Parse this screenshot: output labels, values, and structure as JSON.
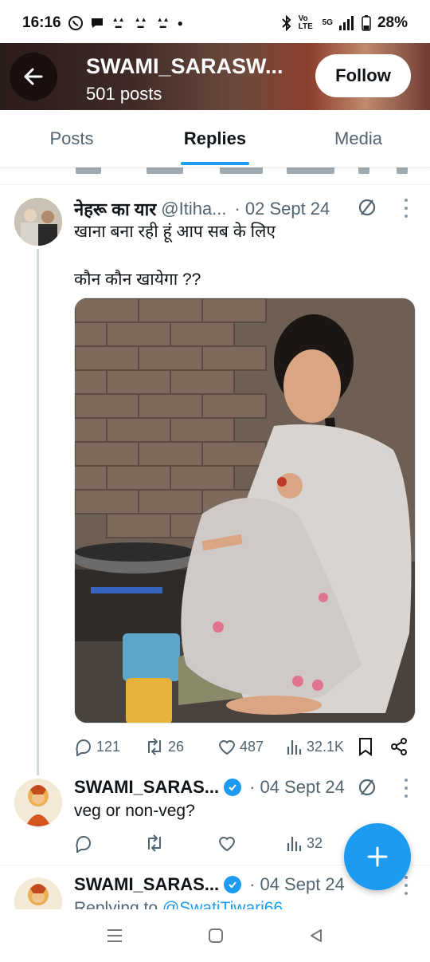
{
  "status_bar": {
    "time": "16:16",
    "battery": "28%",
    "network": "5G",
    "volte": "Vo LTE"
  },
  "header": {
    "title": "SWAMI_SARASW...",
    "posts_count": "501 posts",
    "follow_label": "Follow"
  },
  "tabs": [
    {
      "label": "Posts",
      "active": false
    },
    {
      "label": "Replies",
      "active": true
    },
    {
      "label": "Media",
      "active": false
    }
  ],
  "tweets": [
    {
      "name": "नेहरू का यार",
      "handle": "@Itiha...",
      "date": "02 Sept 24",
      "text_line1": "खाना बना रही हूं आप सब के लिए",
      "text_line2": "कौन कौन खायेगा ??",
      "replies": "121",
      "retweets": "26",
      "likes": "487",
      "views": "32.1K"
    },
    {
      "name": "SWAMI_SARAS...",
      "date": "04 Sept 24",
      "text": "veg or non-veg?",
      "views": "32"
    },
    {
      "name": "SWAMI_SARAS...",
      "date": "04 Sept 24",
      "replying_to_prefix": "Replying to ",
      "replying_to_handle": "@SwatiTiwari66"
    }
  ],
  "colors": {
    "accent": "#1d9bf0",
    "text_primary": "#0f1419",
    "text_secondary": "#536471"
  },
  "icons": [
    "back-arrow-icon",
    "ban-icon",
    "more-icon",
    "reply-icon",
    "retweet-icon",
    "like-icon",
    "views-icon",
    "bookmark-icon",
    "share-icon",
    "plus-icon",
    "verified-icon"
  ]
}
